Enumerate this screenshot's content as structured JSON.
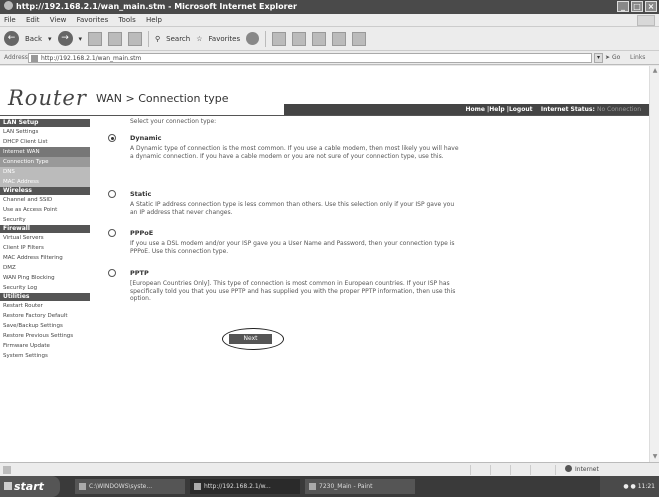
{
  "window": {
    "title": "http://192.168.2.1/wan_main.stm - Microsoft Internet Explorer",
    "controls": [
      "_",
      "□",
      "×"
    ]
  },
  "menu": [
    "File",
    "Edit",
    "View",
    "Favorites",
    "Tools",
    "Help"
  ],
  "toolbar": {
    "back": "Back",
    "search": "Search",
    "favorites": "Favorites"
  },
  "address": {
    "label": "Address",
    "url": "http://192.168.2.1/wan_main.stm",
    "go": "Go",
    "links": "Links"
  },
  "router": {
    "logo": "Router",
    "nav": "Home |Help |Logout",
    "status_label": "Internet Status:",
    "status_value": "No Connection"
  },
  "sidebar": [
    {
      "type": "head",
      "label": "LAN Setup"
    },
    {
      "type": "item",
      "label": "LAN Settings"
    },
    {
      "type": "item",
      "label": "DHCP Client List"
    },
    {
      "type": "sub",
      "label": "Internet WAN"
    },
    {
      "type": "active",
      "label": "Connection Type"
    },
    {
      "type": "gray",
      "label": "DNS"
    },
    {
      "type": "gray",
      "label": "MAC Address"
    },
    {
      "type": "head",
      "label": "Wireless"
    },
    {
      "type": "item",
      "label": "Channel and SSID"
    },
    {
      "type": "item",
      "label": "Use as Access Point"
    },
    {
      "type": "item",
      "label": "Security"
    },
    {
      "type": "head",
      "label": "Firewall"
    },
    {
      "type": "item",
      "label": "Virtual Servers"
    },
    {
      "type": "item",
      "label": "Client IP Filters"
    },
    {
      "type": "item",
      "label": "MAC Address Filtering"
    },
    {
      "type": "item",
      "label": "DMZ"
    },
    {
      "type": "item",
      "label": "WAN Ping Blocking"
    },
    {
      "type": "item",
      "label": "Security Log"
    },
    {
      "type": "head",
      "label": "Utilities"
    },
    {
      "type": "item",
      "label": "Restart Router"
    },
    {
      "type": "item",
      "label": "Restore Factory Default"
    },
    {
      "type": "item",
      "label": "Save/Backup Settings"
    },
    {
      "type": "item",
      "label": "Restore Previous Settings"
    },
    {
      "type": "item",
      "label": "Firmware Update"
    },
    {
      "type": "item",
      "label": "System Settings"
    }
  ],
  "main": {
    "title": "WAN > Connection type",
    "prompt": "Select your connection type:",
    "options": [
      {
        "name": "Dynamic",
        "checked": true,
        "desc": "A Dynamic type of connection is the most common. If you use a cable modem, then most likely you will have a dynamic connection. If you have a cable modem or you are not sure of your connection type, use this."
      },
      {
        "name": "Static",
        "checked": false,
        "desc": "A Static IP address connection type is less common than others. Use this selection only if your ISP gave you an IP address that never changes."
      },
      {
        "name": "PPPoE",
        "checked": false,
        "desc": "If you use a DSL modem and/or your ISP gave you a User Name and Password, then your connection type is PPPoE. Use this connection type."
      },
      {
        "name": "PPTP",
        "checked": false,
        "desc": "[European Countries Only]. This type of connection is most common in European countries. If your ISP has specifically told you that you use PPTP and has supplied you with the proper PPTP information, then use this option."
      }
    ],
    "next": "Next"
  },
  "statusbar": {
    "zone": "Internet"
  },
  "taskbar": {
    "start": "start",
    "tasks": [
      "C:\\WINDOWS\\syste...",
      "http://192.168.2.1/w...",
      "7230_Main - Paint"
    ],
    "clock": "11:21"
  }
}
